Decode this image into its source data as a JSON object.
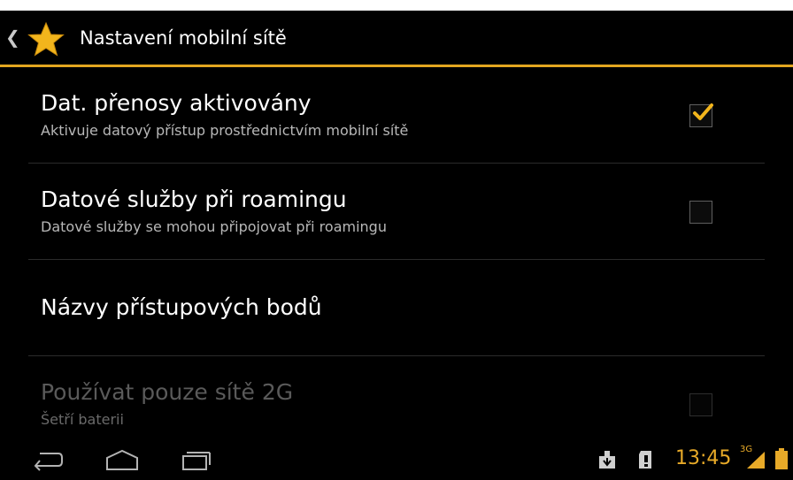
{
  "header": {
    "title": "Nastavení mobilní sítě",
    "accent_color": "#e3a720",
    "back_icon": "chevron-left-icon",
    "app_icon": "star-icon"
  },
  "settings": [
    {
      "title": "Dat. přenosy aktivovány",
      "summary": "Aktivuje datový přístup prostřednictvím mobilní sítě",
      "checked": true,
      "enabled": true
    },
    {
      "title": "Datové služby při roamingu",
      "summary": "Datové služby se mohou připojovat při roamingu",
      "checked": false,
      "enabled": true
    },
    {
      "title": "Názvy přístupových bodů"
    },
    {
      "title": "Používat pouze sítě 2G",
      "summary": "Šetří baterii",
      "checked": false,
      "enabled": false
    }
  ],
  "navbar": {
    "buttons": [
      "back-icon",
      "home-icon",
      "recent-apps-icon"
    ]
  },
  "status": {
    "time": "13:45",
    "network": "3G",
    "icons": [
      "download-icon",
      "sd-card-warning-icon",
      "signal-icon",
      "battery-icon"
    ]
  }
}
